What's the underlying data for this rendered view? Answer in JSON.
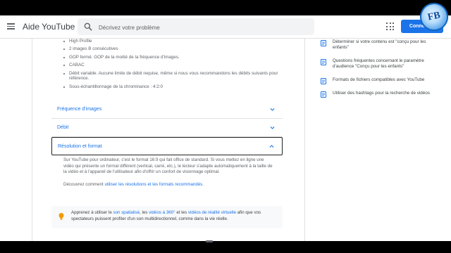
{
  "app": {
    "brand": "Aide YouTube",
    "search_placeholder": "Décrivez votre problème",
    "connect_label": "Connexion",
    "logo_text": "FB"
  },
  "bullets": [
    "High Profile",
    "2 images B consécutives",
    "GOP fermé. GOP de la moitié de la fréquence d'images.",
    "CABAC",
    "Débit variable. Aucune limite de débit requise, même si nous vous recommandons les débits suivants pour référence.",
    "Sous-échantillonnage de la chrominance : 4:2:0"
  ],
  "accordions": [
    {
      "label": "Fréquence d'images",
      "state": "collapsed"
    },
    {
      "label": "Débit",
      "state": "collapsed"
    },
    {
      "label": "Résolution et format",
      "state": "expanded"
    }
  ],
  "resolution": {
    "body": "Sur YouTube pour ordinateur, c'est le format 16:9 qui fait office de standard. Si vous mettez en ligne une vidéo qui présente un format différent (vertical, carré, etc.), le lecteur s'adapte automatiquement à la taille de la vidéo et à l'appareil de l'utilisateur afin d'offrir un confort de visionnage optimal.",
    "link_prefix": "Découvrez comment ",
    "link_text": "utiliser les résolutions et les formats recommandés",
    "link_suffix": "."
  },
  "tip": {
    "p1": "Apprenez à utiliser le ",
    "l1": "son spatialisé",
    "p2": ", les ",
    "l2": "vidéos à 360°",
    "p3": " et les ",
    "l3": "vidéos de réalité virtuelle",
    "p4": " afin que vos spectateurs puissent profiter d'un son multidirectionnel, comme dans la vie réelle."
  },
  "related": [
    "Déterminer si votre contenu est \"conçu pour les enfants\"",
    "Questions fréquentes concernant le paramètre d'audience \"Conçu pour les enfants\"",
    "Formats de fichiers compatibles avec YouTube",
    "Utiliser des hashtags pour la recherche de vidéos"
  ],
  "colors": {
    "link": "#1a73e8",
    "button": "#1a73e8",
    "tip_bulb": "#f29900",
    "text_secondary": "#5f6368"
  },
  "icons": {
    "menu": "menu-icon",
    "search": "search-icon",
    "apps": "apps-grid-icon",
    "chevron": "chevron-icon",
    "tip": "lightbulb-icon",
    "related": "document-icon"
  }
}
